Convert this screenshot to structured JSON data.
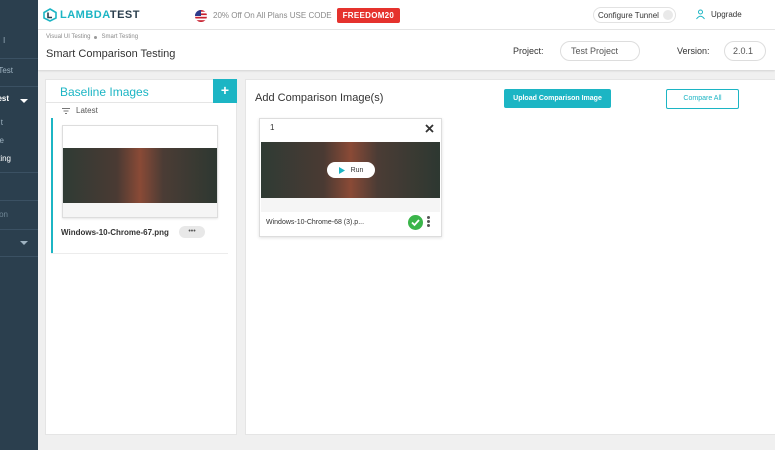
{
  "app": {
    "logo_prefix": "LAMBDA",
    "logo_suffix": "TEST",
    "promo_text": "20% Off On All Plans USE CODE",
    "promo_code": "FREEDOM20",
    "configure_tunnel": "Configure Tunnel",
    "upgrade": "Upgrade",
    "accent_color": "#1cb5c4",
    "sidebar_color": "#2b3f4e"
  },
  "sidebar": {
    "items": [
      {
        "label": "l"
      },
      {
        "label": "Test"
      },
      {
        "label": "est"
      },
      {
        "label": "t"
      },
      {
        "label": "e"
      },
      {
        "label": "ting"
      },
      {
        "label": ""
      },
      {
        "label": "on"
      }
    ]
  },
  "breadcrumb": [
    "Visual UI Testing",
    "Smart Testing"
  ],
  "page_title": "Smart Comparison Testing",
  "project": {
    "label": "Project:",
    "value": "Test Project"
  },
  "version": {
    "label": "Version:",
    "value": "2.0.1"
  },
  "baseline": {
    "title": "Baseline Images",
    "add_label": "+",
    "sort_label": "Latest",
    "items": [
      {
        "name": "Windows-10-Chrome-67.png",
        "more": "•••"
      }
    ]
  },
  "compare": {
    "title": "Add Comparison Image(s)",
    "upload_label": "Upload Comparison Image",
    "compare_all_label": "Compare All",
    "cards": [
      {
        "index": "1",
        "name": "Windows-10-Chrome-68 (3).p...",
        "run_label": "Run",
        "status": "success"
      }
    ]
  }
}
